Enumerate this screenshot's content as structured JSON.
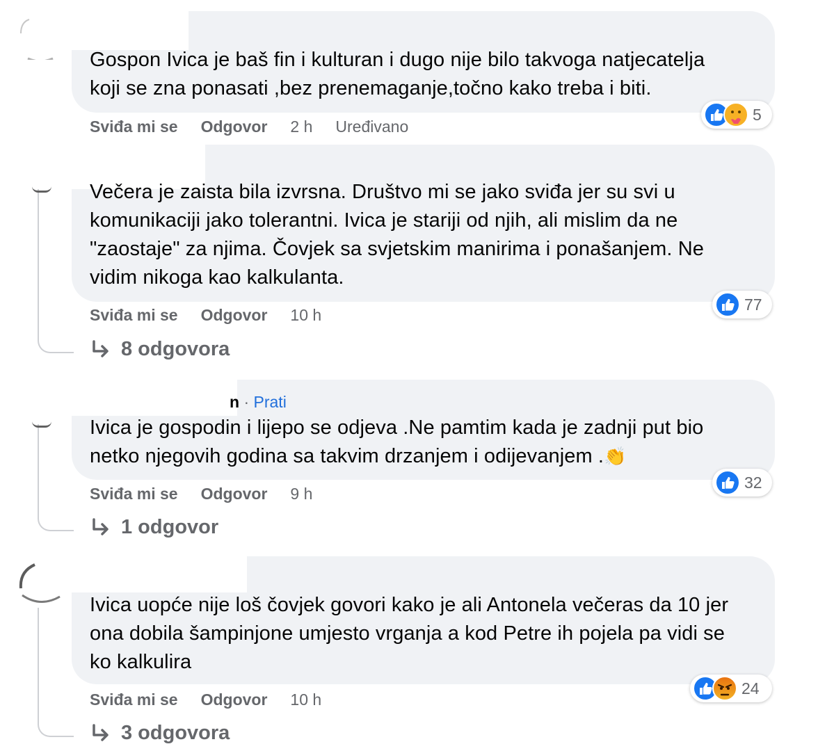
{
  "comments": [
    {
      "text_lines": [
        "Gospon Ivica je baš fin i kulturan i dugo nije bilo takvoga natjecatelja",
        "koji se zna ponasati ,bez prenemaganje,točno kako treba i biti."
      ],
      "actions": {
        "like": "Sviđa mi se",
        "reply": "Odgovor",
        "time": "2 h",
        "edited": "Uređivano"
      },
      "reaction_icons": [
        "like-icon",
        "care-icon"
      ],
      "reaction_count": "5"
    },
    {
      "text_lines": [
        "Večera je zaista bila izvrsna. Društvo mi se jako sviđa jer su svi u",
        "komunikaciji jako tolerantni. Ivica je stariji od njih, ali mislim da ne",
        "\"zaostaje\" za njima. Čovjek sa svjetskim manirima i ponašanjem. Ne",
        "vidim nikoga kao kalkulanta."
      ],
      "actions": {
        "like": "Sviđa mi se",
        "reply": "Odgovor",
        "time": "10 h"
      },
      "reaction_icons": [
        "like-icon"
      ],
      "reaction_count": "77",
      "replies_label": "8 odgovora"
    },
    {
      "author_suffix": "n",
      "follow_label": "Prati",
      "text_lines": [
        "Ivica je gospodin i lijepo se odjeva .Ne pamtim kada je zadnji put bio",
        "netko njegovih godina sa takvim drzanjem i odijevanjem ."
      ],
      "emoji": "👏",
      "actions": {
        "like": "Sviđa mi se",
        "reply": "Odgovor",
        "time": "9 h"
      },
      "reaction_icons": [
        "like-icon"
      ],
      "reaction_count": "32",
      "replies_label": "1 odgovor"
    },
    {
      "text_lines": [
        "Ivica uopće nije loš čovjek govori kako je ali Antonela večeras da 10 jer",
        "ona dobila šampinjone umjesto vrganja a kod Petre ih pojela pa vidi se",
        "ko kalkulira"
      ],
      "actions": {
        "like": "Sviđa mi se",
        "reply": "Odgovor",
        "time": "10 h"
      },
      "reaction_icons": [
        "like-icon",
        "angry-icon"
      ],
      "reaction_count": "24",
      "replies_label": "3 odgovora"
    }
  ],
  "colors": {
    "bubble": "#f0f2f5",
    "meta": "#65676b",
    "link": "#216fdb",
    "like_blue": "#1877f2",
    "thread_line": "#ced0d4"
  }
}
